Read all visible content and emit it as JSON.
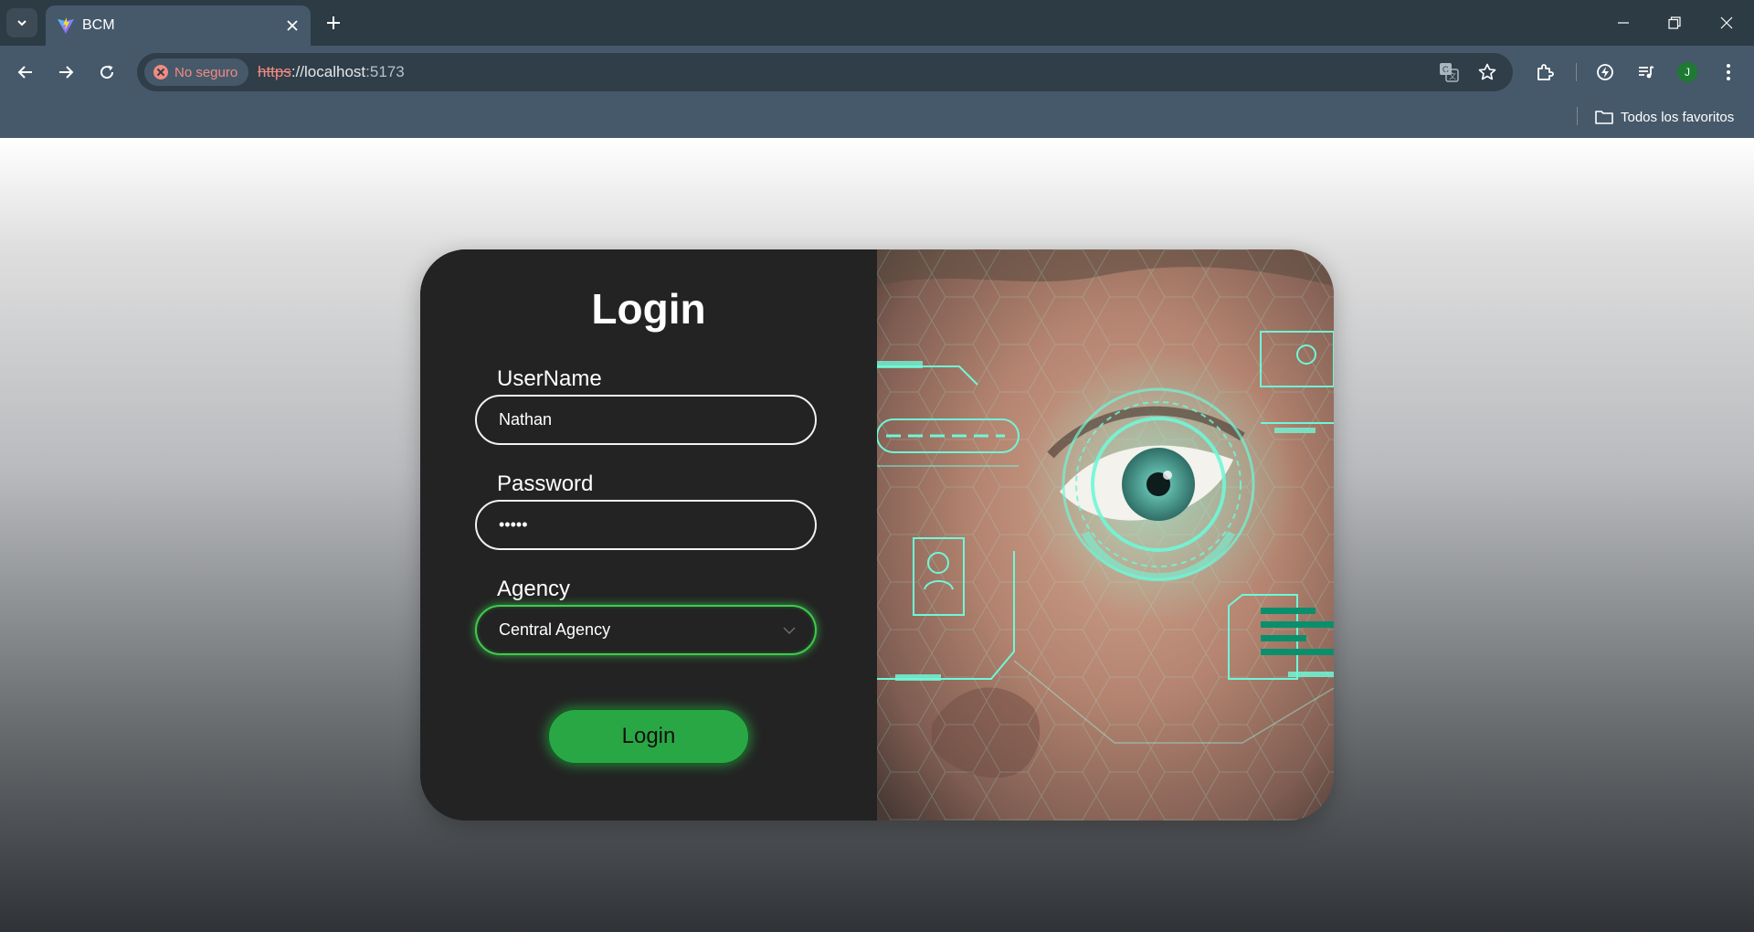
{
  "browser": {
    "tab_title": "BCM",
    "security_label": "No seguro",
    "url_scheme": "https",
    "url_sep": "://",
    "url_host": "localhost",
    "url_port": ":5173",
    "bookmarks_folder_label": "Todos los favoritos",
    "profile_initial": "J",
    "icons": [
      "tab-search-icon",
      "vite-favicon-icon",
      "close-icon",
      "plus-icon",
      "minimize-icon",
      "restore-icon",
      "window-close-icon",
      "back-arrow-icon",
      "forward-arrow-icon",
      "reload-icon",
      "translate-icon",
      "star-icon",
      "extensions-icon",
      "performance-icon",
      "media-controls-icon",
      "more-vert-icon",
      "folder-icon"
    ]
  },
  "login": {
    "title": "Login",
    "username_label": "UserName",
    "username_value": "Nathan",
    "password_label": "Password",
    "password_value": "•••••",
    "agency_label": "Agency",
    "agency_selected": "Central Agency",
    "submit_label": "Login"
  },
  "colors": {
    "card_bg": "#232323",
    "accent_green": "#2aa745",
    "hud_cyan": "#5ff5d2",
    "chrome_toolbar": "#46596a",
    "chrome_tabbar": "#2d3b45",
    "insecure_red": "#f28b82"
  }
}
